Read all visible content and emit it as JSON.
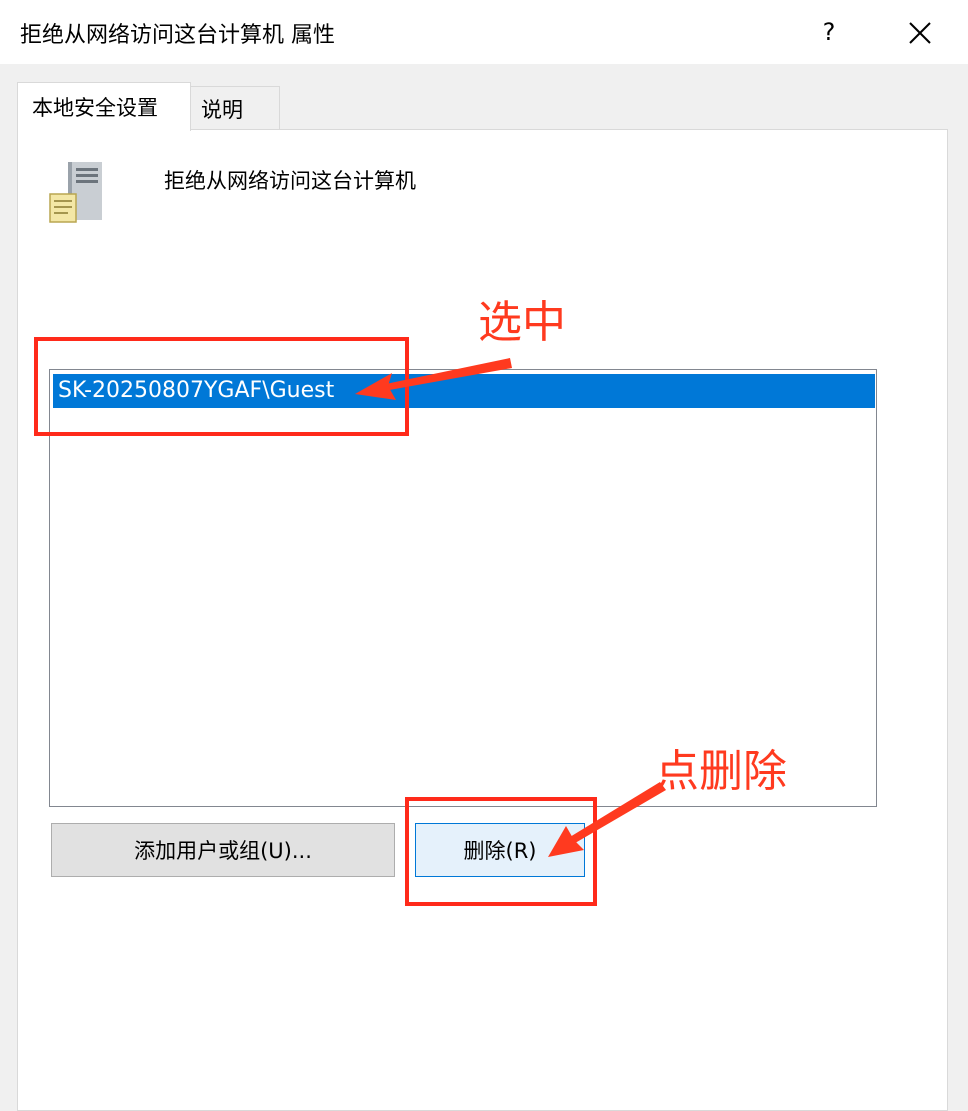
{
  "window": {
    "title": "拒绝从网络访问这台计算机 属性",
    "help_label": "?",
    "close_icon": "close-icon"
  },
  "tabs": [
    {
      "label": "本地安全设置",
      "active": true
    },
    {
      "label": "说明",
      "active": false
    }
  ],
  "policy": {
    "icon": "server-policy-icon",
    "name": "拒绝从网络访问这台计算机"
  },
  "list": {
    "items": [
      {
        "label": "SK-20250807YGAF\\Guest",
        "selected": true
      }
    ]
  },
  "buttons": {
    "add_label": "添加用户或组(U)...",
    "remove_label": "删除(R)"
  },
  "annotations": {
    "select_label": "选中",
    "remove_hint": "点删除",
    "color": "#ff3a1f"
  },
  "colors": {
    "selection": "#0078d7",
    "focus_border": "#0078d7"
  }
}
